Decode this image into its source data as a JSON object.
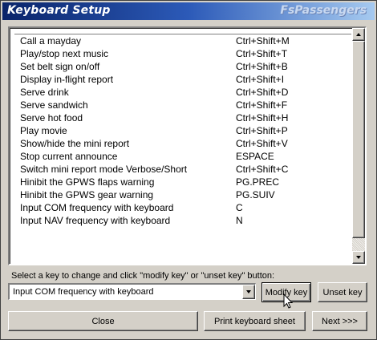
{
  "window": {
    "title": "Keyboard Setup",
    "brand": "FsPassengers"
  },
  "shortcuts": [
    {
      "action": "Call a mayday",
      "key": "Ctrl+Shift+M"
    },
    {
      "action": "Play/stop next music",
      "key": "Ctrl+Shift+T"
    },
    {
      "action": "Set belt sign on/off",
      "key": "Ctrl+Shift+B"
    },
    {
      "action": "Display in-flight report",
      "key": "Ctrl+Shift+I"
    },
    {
      "action": "Serve drink",
      "key": "Ctrl+Shift+D"
    },
    {
      "action": "Serve sandwich",
      "key": "Ctrl+Shift+F"
    },
    {
      "action": "Serve hot food",
      "key": "Ctrl+Shift+H"
    },
    {
      "action": "Play movie",
      "key": "Ctrl+Shift+P"
    },
    {
      "action": "Show/hide the mini report",
      "key": "Ctrl+Shift+V"
    },
    {
      "action": "Stop current announce",
      "key": "ESPACE"
    },
    {
      "action": "Switch mini report mode Verbose/Short",
      "key": "Ctrl+Shift+C"
    },
    {
      "action": "Hinibit the GPWS flaps warning",
      "key": "PG.PREC"
    },
    {
      "action": "Hinibit the GPWS gear warning",
      "key": "PG.SUIV"
    },
    {
      "action": "Input COM frequency with keyboard",
      "key": "C"
    },
    {
      "action": "Input NAV frequency with keyboard",
      "key": "N"
    }
  ],
  "instruction": "Select a key to change and click \"modify key\" or \"unset key\" button:",
  "combo": {
    "selected": "Input COM frequency with keyboard"
  },
  "buttons": {
    "modify": "Modify key",
    "unset": "Unset key",
    "close": "Close",
    "print": "Print keyboard sheet",
    "next": "Next >>>"
  },
  "colors": {
    "titlebar_start": "#0a246a",
    "titlebar_end": "#a6caf0",
    "face": "#d4d0c8"
  },
  "icons": {
    "cursor": "arrow-pointer-icon",
    "scroll_up": "scroll-up-arrow-icon",
    "scroll_down": "scroll-down-arrow-icon",
    "combo_drop": "dropdown-arrow-icon"
  }
}
